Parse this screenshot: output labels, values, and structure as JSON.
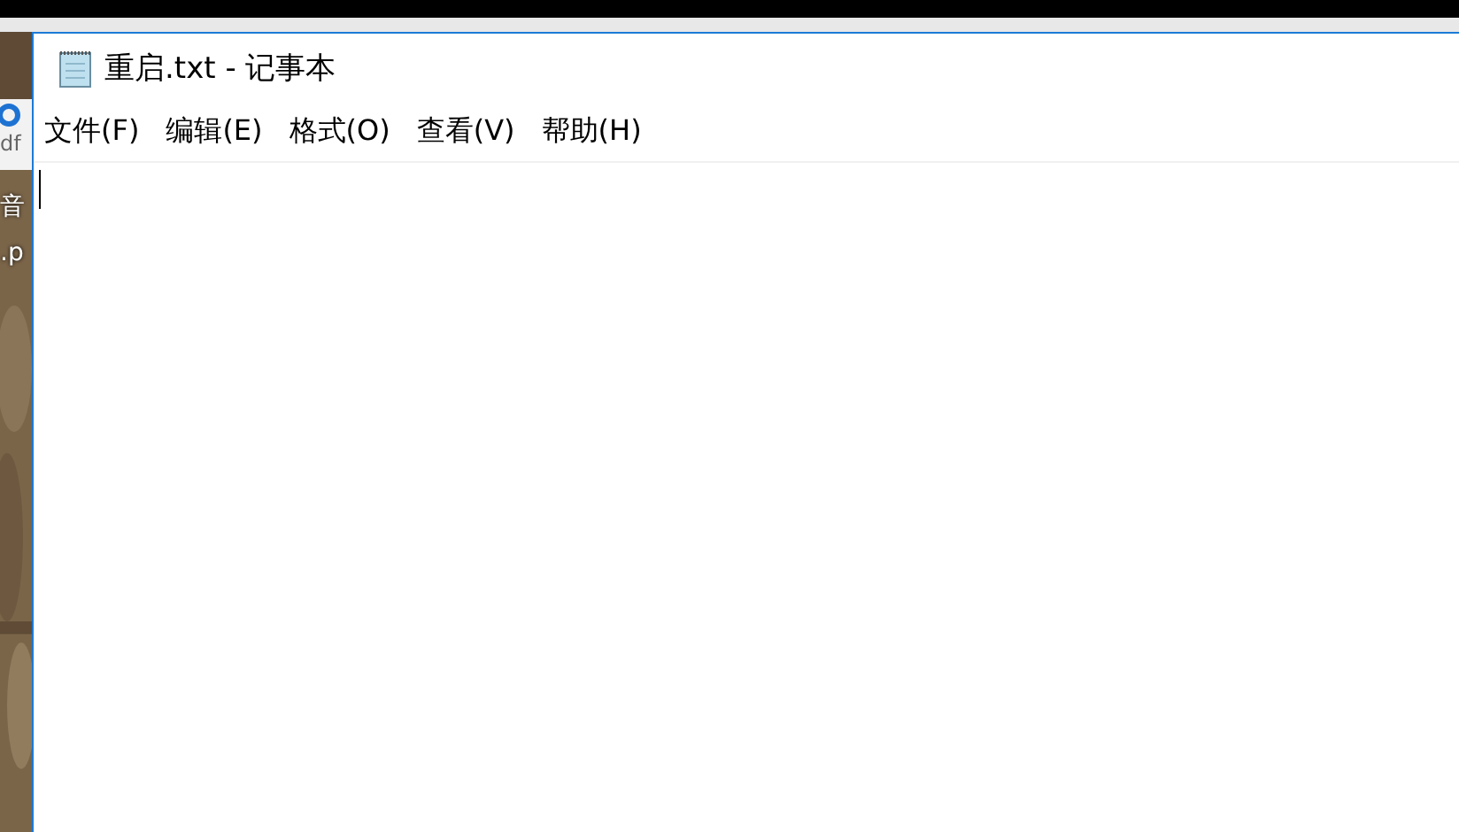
{
  "desktop": {
    "icons": [
      {
        "badge": "df",
        "label_lines": [
          "音",
          ".p"
        ]
      }
    ]
  },
  "window": {
    "title": "重启.txt - 记事本"
  },
  "menu": [
    "文件(F)",
    "编辑(E)",
    "格式(O)",
    "查看(V)",
    "帮助(H)"
  ]
}
